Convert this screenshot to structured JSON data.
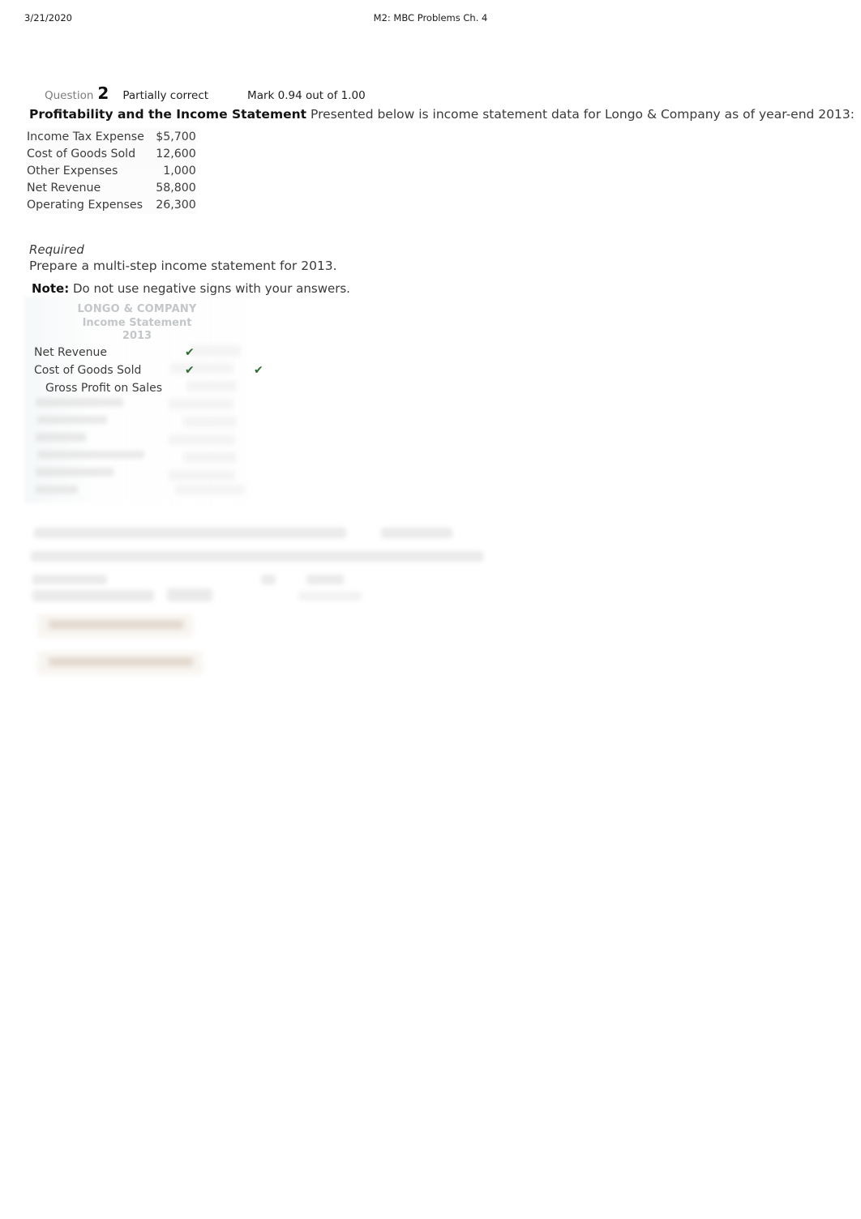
{
  "print_header": {
    "date": "3/21/2020",
    "title": "M2: MBC Problems Ch. 4"
  },
  "question": {
    "label": "Question",
    "number": "2",
    "status": "Partially correct",
    "mark": "Mark 0.94 out of 1.00"
  },
  "problem": {
    "heading": "Profitability and the Income Statement",
    "prompt": "Presented below is income statement data for Longo & Company as of year-end 2013:"
  },
  "given_data": {
    "rows": [
      {
        "label": "Income Tax Expense",
        "value": "$5,700"
      },
      {
        "label": "Cost of Goods Sold",
        "value": "12,600"
      },
      {
        "label": "Other Expenses",
        "value": "1,000"
      },
      {
        "label": "Net Revenue",
        "value": "58,800"
      },
      {
        "label": "Operating Expenses",
        "value": "26,300"
      }
    ]
  },
  "required": {
    "heading": "Required",
    "text": "Prepare a multi-step income statement for 2013.",
    "note_label": "Note:",
    "note_text": "Do not use negative signs with your answers."
  },
  "statement": {
    "company": "LONGO & COMPANY",
    "title": "Income Statement",
    "year": "2013",
    "rows": [
      {
        "label": "Net Revenue",
        "indent": false,
        "check1": "✔",
        "check2": ""
      },
      {
        "label": "Cost of Goods Sold",
        "indent": false,
        "check1": "✔",
        "check2": "✔"
      },
      {
        "label": "Gross Profit on Sales",
        "indent": true,
        "check1": "",
        "check2": ""
      }
    ],
    "check_glyph": "✔",
    "check_color": "#2e6b30"
  },
  "obscured": {
    "note": "Remaining statement rows, following paragraphs and feedback banners are blurred and unreadable in the source screenshot.",
    "banner_color": "#f6f1ea"
  }
}
